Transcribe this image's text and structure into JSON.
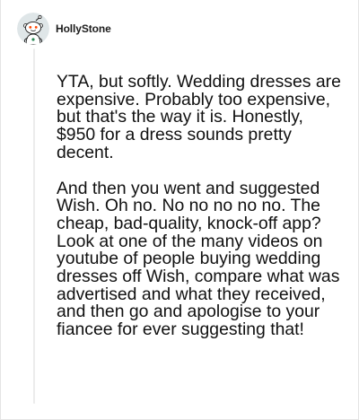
{
  "comment": {
    "author": {
      "username": "HollyStone",
      "avatar_icon": "reddit-snoo-avatar-icon"
    },
    "paragraphs": [
      "YTA, but softly. Wedding dresses are expensive. Probably too expensive, but that's the way it is. Honestly, $950 for a dress sounds pretty decent.",
      "And then you went and suggested Wish. Oh no. No no no no no. The cheap, bad-quality, knock-off app? Look at one of the many videos on youtube of people buying wedding dresses off Wish, compare what was advertised and what they received, and then go and apologise to your fiancee for ever suggesting that!"
    ]
  },
  "colors": {
    "background": "#ffffff",
    "text": "#111111",
    "thread_line": "#ececec",
    "avatar_bg": "#dfe6e8"
  }
}
